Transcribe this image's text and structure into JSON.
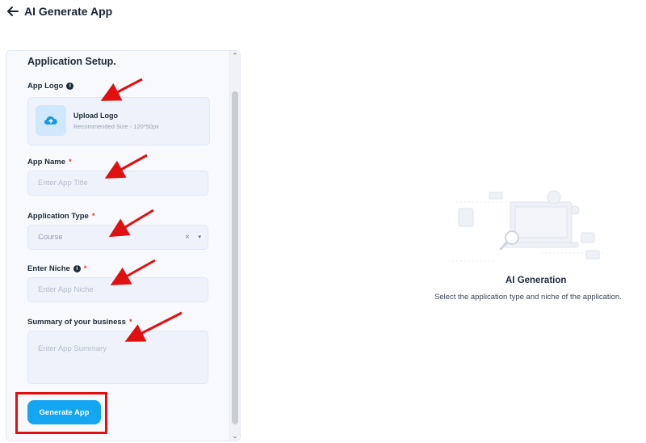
{
  "header": {
    "title": "AI Generate App"
  },
  "form": {
    "section_title": "Application Setup.",
    "logo": {
      "label": "App Logo",
      "upload_title": "Upload Logo",
      "upload_hint": "Recommended Size - 120*50px"
    },
    "app_name": {
      "label": "App Name",
      "required": "*",
      "placeholder": "Enter App Title"
    },
    "app_type": {
      "label": "Application Type",
      "required": "*",
      "value": "Course",
      "clear": "×",
      "caret": "▾"
    },
    "niche": {
      "label": "Enter Niche",
      "required": "*",
      "placeholder": "Enter App Niche"
    },
    "summary": {
      "label": "Summary of your business",
      "required": "*",
      "placeholder": "Enter App Summary"
    },
    "generate_label": "Generate App"
  },
  "empty_state": {
    "title": "AI Generation",
    "subtitle": "Select the application type and niche of the application."
  },
  "colors": {
    "accent": "#15a6f2",
    "annotation": "#e01010"
  }
}
